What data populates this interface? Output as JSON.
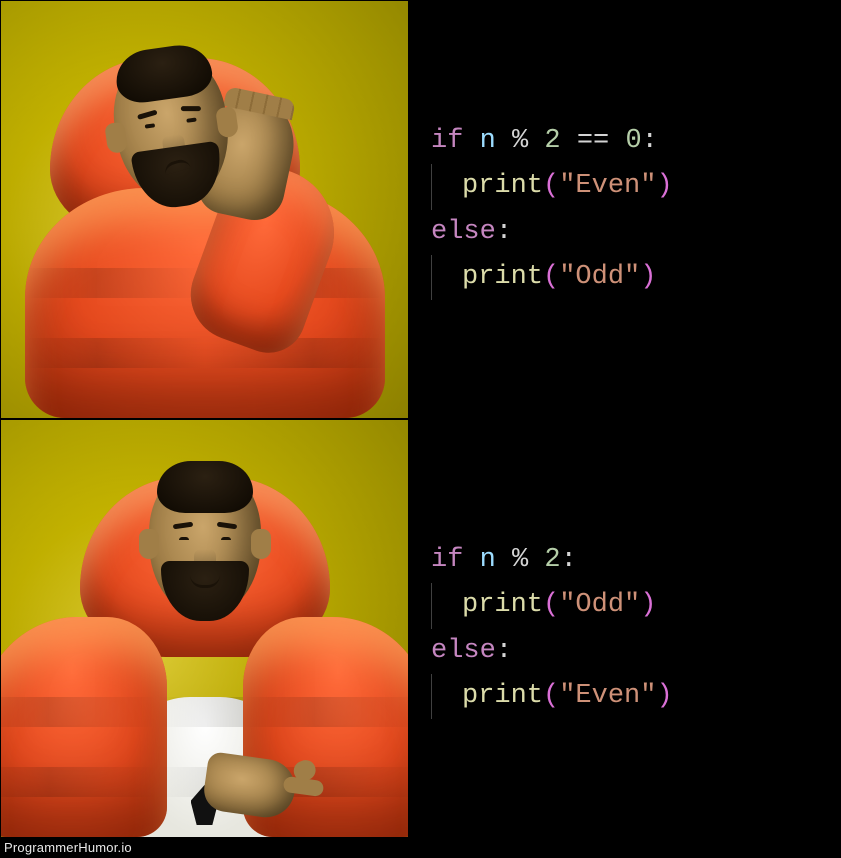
{
  "meme": {
    "template": "drake-hotline-bling",
    "panels": {
      "top": {
        "reaction": "reject",
        "image_semantic": "drake-reject"
      },
      "bottom": {
        "reaction": "approve",
        "image_semantic": "drake-approve"
      }
    }
  },
  "code": {
    "top": {
      "line1": {
        "kw": "if",
        "var": "n",
        "op1": "%",
        "num1": "2",
        "op2": "==",
        "num2": "0",
        "colon": ":"
      },
      "line2": {
        "fn": "print",
        "lpar": "(",
        "str": "\"Even\"",
        "rpar": ")"
      },
      "line3": {
        "kw": "else",
        "colon": ":"
      },
      "line4": {
        "fn": "print",
        "lpar": "(",
        "str": "\"Odd\"",
        "rpar": ")"
      }
    },
    "bottom": {
      "line1": {
        "kw": "if",
        "var": "n",
        "op1": "%",
        "num1": "2",
        "colon": ":"
      },
      "line2": {
        "fn": "print",
        "lpar": "(",
        "str": "\"Odd\"",
        "rpar": ")"
      },
      "line3": {
        "kw": "else",
        "colon": ":"
      },
      "line4": {
        "fn": "print",
        "lpar": "(",
        "str": "\"Even\"",
        "rpar": ")"
      }
    }
  },
  "watermark": "ProgrammerHumor.io"
}
